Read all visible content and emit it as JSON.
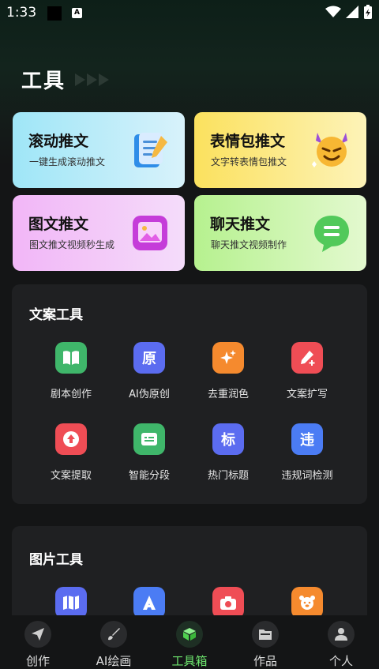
{
  "status": {
    "time": "1:33",
    "app_badge": "A"
  },
  "page": {
    "title": "工具"
  },
  "feature_cards": [
    {
      "title": "滚动推文",
      "subtitle": "一键生成滚动推文",
      "icon": "notebook-pen-icon"
    },
    {
      "title": "表情包推文",
      "subtitle": "文字转表情包推文",
      "icon": "devil-emoji-icon"
    },
    {
      "title": "图文推文",
      "subtitle": "图文推文视频秒生成",
      "icon": "picture-frame-icon"
    },
    {
      "title": "聊天推文",
      "subtitle": "聊天推文视频制作",
      "icon": "chat-bubble-icon"
    }
  ],
  "copy_tools": {
    "title": "文案工具",
    "items": [
      {
        "label": "剧本创作",
        "glyph": "",
        "color": "#3fb66a",
        "icon": "book-icon"
      },
      {
        "label": "AI伪原创",
        "glyph": "原",
        "color": "#5b6cf0",
        "icon": "original-icon"
      },
      {
        "label": "去重润色",
        "glyph": "",
        "color": "#f58a2e",
        "icon": "sparkle-icon"
      },
      {
        "label": "文案扩写",
        "glyph": "",
        "color": "#ef4d55",
        "icon": "pen-plus-icon"
      },
      {
        "label": "文案提取",
        "glyph": "",
        "color": "#ef4d55",
        "icon": "upload-circle-icon"
      },
      {
        "label": "智能分段",
        "glyph": "",
        "color": "#3fb66a",
        "icon": "message-lines-icon"
      },
      {
        "label": "热门标题",
        "glyph": "标",
        "color": "#5b6cf0",
        "icon": "title-icon"
      },
      {
        "label": "违规词检测",
        "glyph": "违",
        "color": "#4b7cf4",
        "icon": "violation-icon"
      }
    ]
  },
  "image_tools": {
    "title": "图片工具",
    "items": [
      {
        "icon": "map-icon",
        "color": "#5b6cf0"
      },
      {
        "icon": "ai-letter-icon",
        "color": "#4b7cf4"
      },
      {
        "icon": "camera-icon",
        "color": "#ef4d55"
      },
      {
        "icon": "bear-icon",
        "color": "#f58a2e"
      }
    ]
  },
  "tabbar": [
    {
      "label": "创作",
      "icon": "paper-plane-icon"
    },
    {
      "label": "AI绘画",
      "icon": "brush-icon"
    },
    {
      "label": "工具箱",
      "icon": "cube-icon",
      "active": true
    },
    {
      "label": "作品",
      "icon": "folder-icon"
    },
    {
      "label": "个人",
      "icon": "person-icon"
    }
  ],
  "colors": {
    "accent": "#6ee66e",
    "background": "#141516",
    "panel": "#1f2022"
  }
}
